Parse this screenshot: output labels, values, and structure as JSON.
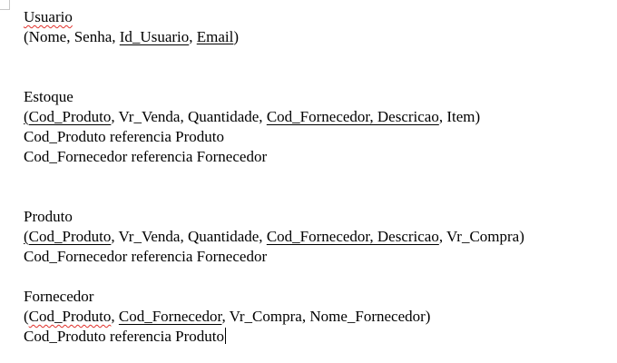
{
  "usuario": {
    "title": "Usuario",
    "open": "(",
    "f1": "Nome, Senha, ",
    "f2": "Id_Usuario",
    "f3": ", ",
    "f4": "Email",
    "close": ")"
  },
  "estoque": {
    "title": "Estoque",
    "open": "(",
    "f1": "Cod_Produto",
    "f2": ", Vr_Venda, Quantidade, ",
    "f3": "Cod_Fornecedor, Descricao",
    "f4": ", Item)",
    "ref1": "Cod_Produto referencia Produto",
    "ref2": "Cod_Fornecedor referencia Fornecedor"
  },
  "produto": {
    "title": "Produto",
    "open": "(",
    "f1": "Cod_Produto",
    "f2": ", Vr_Venda, Quantidade, ",
    "f3": "Cod_Fornecedor, Descricao",
    "f4": ", Vr_Compra)",
    "ref1": "Cod_Fornecedor referencia Fornecedor"
  },
  "fornecedor": {
    "title": "Fornecedor",
    "open": "(",
    "f1": "Cod_Produto",
    "f2": ", ",
    "f3": "Cod_Fornecedor",
    "f4": ", Vr_Compra, Nome_Fornecedor)",
    "ref1": "Cod_Produto referencia Produto"
  },
  "colors": {
    "text": "#000000",
    "spellcheck": "#e0302a",
    "background": "#ffffff"
  }
}
